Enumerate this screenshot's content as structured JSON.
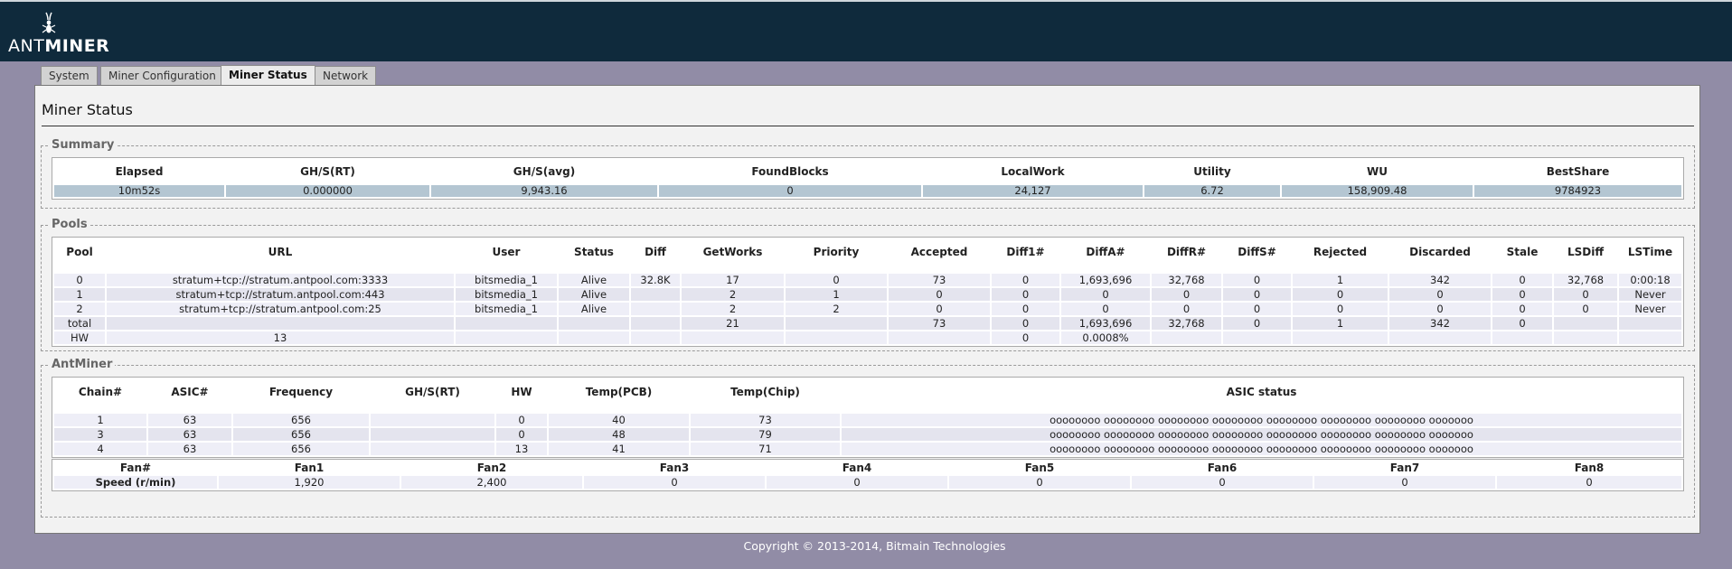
{
  "brand": {
    "prefix": "ANT",
    "suffix": "MINER",
    "icon": "ant-logo-icon"
  },
  "tabs": [
    {
      "label": "System",
      "active": false
    },
    {
      "label": "Miner Configuration",
      "active": false
    },
    {
      "label": "Miner Status",
      "active": true
    },
    {
      "label": "Network",
      "active": false
    }
  ],
  "page_title": "Miner Status",
  "summary": {
    "legend": "Summary",
    "headers": [
      "Elapsed",
      "GH/S(RT)",
      "GH/S(avg)",
      "FoundBlocks",
      "LocalWork",
      "Utility",
      "WU",
      "BestShare"
    ],
    "values": [
      "10m52s",
      "0.000000",
      "9,943.16",
      "0",
      "24,127",
      "6.72",
      "158,909.48",
      "9784923"
    ]
  },
  "pools": {
    "legend": "Pools",
    "headers": [
      "Pool",
      "URL",
      "User",
      "Status",
      "Diff",
      "GetWorks",
      "Priority",
      "Accepted",
      "Diff1#",
      "DiffA#",
      "DiffR#",
      "DiffS#",
      "Rejected",
      "Discarded",
      "Stale",
      "LSDiff",
      "LSTime"
    ],
    "rows": [
      [
        "0",
        "stratum+tcp://stratum.antpool.com:3333",
        "bitsmedia_1",
        "Alive",
        "32.8K",
        "17",
        "0",
        "73",
        "0",
        "1,693,696",
        "32,768",
        "0",
        "1",
        "342",
        "0",
        "32,768",
        "0:00:18"
      ],
      [
        "1",
        "stratum+tcp://stratum.antpool.com:443",
        "bitsmedia_1",
        "Alive",
        "",
        "2",
        "1",
        "0",
        "0",
        "0",
        "0",
        "0",
        "0",
        "0",
        "0",
        "0",
        "Never"
      ],
      [
        "2",
        "stratum+tcp://stratum.antpool.com:25",
        "bitsmedia_1",
        "Alive",
        "",
        "2",
        "2",
        "0",
        "0",
        "0",
        "0",
        "0",
        "0",
        "0",
        "0",
        "0",
        "Never"
      ],
      [
        "total",
        "",
        "",
        "",
        "",
        "21",
        "",
        "73",
        "0",
        "1,693,696",
        "32,768",
        "0",
        "1",
        "342",
        "0",
        "",
        ""
      ],
      [
        "HW",
        "13",
        "",
        "",
        "",
        "",
        "",
        "",
        "0",
        "0.0008%",
        "",
        "",
        "",
        "",
        "",
        "",
        ""
      ]
    ]
  },
  "antminer": {
    "legend": "AntMiner",
    "headers": [
      "Chain#",
      "ASIC#",
      "Frequency",
      "GH/S(RT)",
      "HW",
      "Temp(PCB)",
      "Temp(Chip)",
      "ASIC status"
    ],
    "rows": [
      [
        "1",
        "63",
        "656",
        "",
        "0",
        "40",
        "73",
        "oooooooo oooooooo oooooooo oooooooo oooooooo oooooooo oooooooo ooooooo"
      ],
      [
        "3",
        "63",
        "656",
        "",
        "0",
        "48",
        "79",
        "oooooooo oooooooo oooooooo oooooooo oooooooo oooooooo oooooooo ooooooo"
      ],
      [
        "4",
        "63",
        "656",
        "",
        "13",
        "41",
        "71",
        "oooooooo oooooooo oooooooo oooooooo oooooooo oooooooo oooooooo ooooooo"
      ]
    ]
  },
  "fans": {
    "headers": [
      "Fan#",
      "Fan1",
      "Fan2",
      "Fan3",
      "Fan4",
      "Fan5",
      "Fan6",
      "Fan7",
      "Fan8"
    ],
    "row_label": "Speed (r/min)",
    "values": [
      "1,920",
      "2,400",
      "0",
      "0",
      "0",
      "0",
      "0",
      "0"
    ]
  },
  "footer": "Copyright © 2013-2014, Bitmain Technologies"
}
